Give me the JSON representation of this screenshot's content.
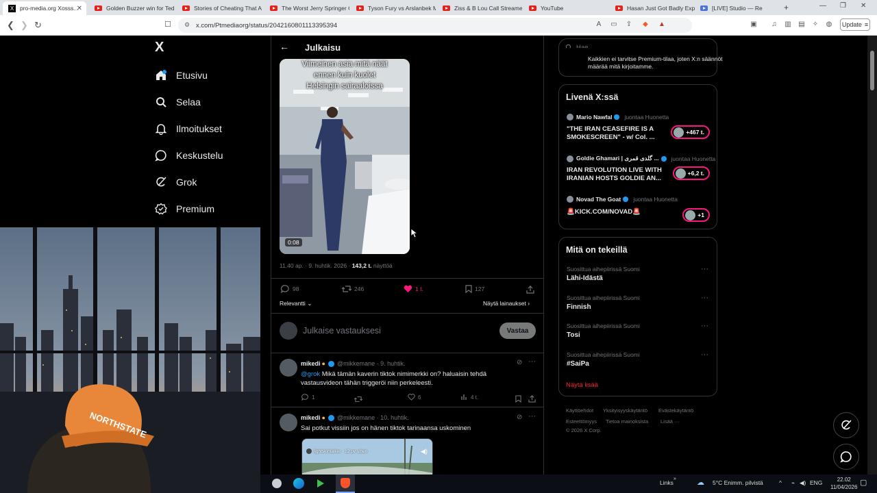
{
  "browser": {
    "tabs": [
      {
        "label": "pro-media.org Xosss...",
        "active": true
      },
      {
        "label": "Golden Buzzer win for Ted"
      },
      {
        "label": "Stories of Cheating That A"
      },
      {
        "label": "The Worst Jerry Springer G"
      },
      {
        "label": "Tyson Fury vs Arslanbek M"
      },
      {
        "label": "Ziss & B Lou Call Streame"
      },
      {
        "label": "YouTube"
      },
      {
        "label": "Hasan Just Got Badly Expo"
      },
      {
        "label": "[LIVE] Studio — Re"
      }
    ],
    "url": "x.com/Ptmediaorg/status/2042160801113395394",
    "update_label": "Update"
  },
  "nav": {
    "logo": "X",
    "items": [
      {
        "label": "Etusivu",
        "icon": "home-icon"
      },
      {
        "label": "Selaa",
        "icon": "search-icon"
      },
      {
        "label": "Ilmoitukset",
        "icon": "bell-icon"
      },
      {
        "label": "Keskustelu",
        "icon": "chat-icon"
      },
      {
        "label": "Grok",
        "icon": "grok-icon"
      },
      {
        "label": "Premium",
        "icon": "premium-icon"
      }
    ]
  },
  "post": {
    "header_title": "Julkaisu",
    "video_caption_lines": [
      "Viimeinen asia mitä näät",
      "ennen kuin kuolet",
      "Helsingin sairaaloissa"
    ],
    "video_duration": "0:08",
    "meta_time": "11.40 ap. · 9. huhtik. 2026 ·",
    "views_count": "143,2 t.",
    "views_label": "näyttöä",
    "actions": {
      "replies": "98",
      "reposts": "246",
      "likes": "1 t.",
      "bookmarks": "127"
    },
    "sort_label": "Relevantti",
    "quotes_label": "Näytä lainaukset",
    "reply_placeholder": "Julkaise vastauksesi",
    "reply_button": "Vastaa"
  },
  "replies": [
    {
      "name": "mikedi",
      "handle": "@mikkemane · 9. huhtik.",
      "mention": "@grok",
      "text": " Mikä tämän kaverin tiktok nimimerkki on? haluaisin tehdä vastausvideon tähän triggeröi niin perkeleesti.",
      "replies": "1",
      "reposts": "",
      "likes": "6",
      "views": "4 t."
    },
    {
      "name": "mikedi",
      "handle": "@mikkemane · 10. huhtik.",
      "text": "Sai potkut vissiin jos on hänen tiktok tarinaansa uskominen",
      "embed_user": "lightskintalker · 12 pv sitten"
    }
  ],
  "search": {
    "placeholder": "Hae"
  },
  "top_card_text": [
    "Kaikkien ei tarvitse Premium-tilaa, joten X:n säännöt",
    "määrää mitä kirjoitamme."
  ],
  "live": {
    "title": "Livenä X:ssä",
    "items": [
      {
        "user": "Mario Nawfal",
        "status": "juontaa Huonetta",
        "text": "\"THE IRAN CEASEFIRE IS A SMOKESCREEN\" - w/ Col. ...",
        "count": "+467 t."
      },
      {
        "user": "Goldie Ghamari | گلدی قمری ...",
        "status": "juontaa Huonetta",
        "text": "IRAN REVOLUTION LIVE WITH IRANIAN HOSTS GOLDIE AN...",
        "count": "+6,2 t."
      },
      {
        "user": "Novad The Goat",
        "status": "juontaa Huonetta",
        "text": "🚨KICK.COM/NOVAD🚨",
        "count": "+1"
      }
    ]
  },
  "trends": {
    "title": "Mitä on tekeillä",
    "items": [
      {
        "category": "Suosittua aihepiirissä Suomi",
        "name": "Lähi-Idästä"
      },
      {
        "category": "Suosittua aihepiirissä Suomi",
        "name": "Finnish"
      },
      {
        "category": "Suosittua aihepiirissä Suomi",
        "name": "Tosi"
      },
      {
        "category": "Suosittua aihepiirissä Suomi",
        "name": "#SaiPa"
      }
    ],
    "show_more": "Näytä lisää"
  },
  "footer_links": [
    "Käyttöehdot",
    "Yksityisyyskäytäntö",
    "Evästekäytäntö",
    "Esteettömyys",
    "Tietoa mainoksista",
    "Lisää ···",
    "© 2026 X Corp."
  ],
  "taskbar": {
    "links": "Links",
    "weather": "5°C  Enimm. pilvistä",
    "lang": "ENG",
    "time": "22.02",
    "date": "11/04/2026"
  },
  "colors": {
    "like": "#f91880",
    "accent": "#1d9bf0",
    "live_ring": "#f91880",
    "trend_more": "#f4212e"
  }
}
